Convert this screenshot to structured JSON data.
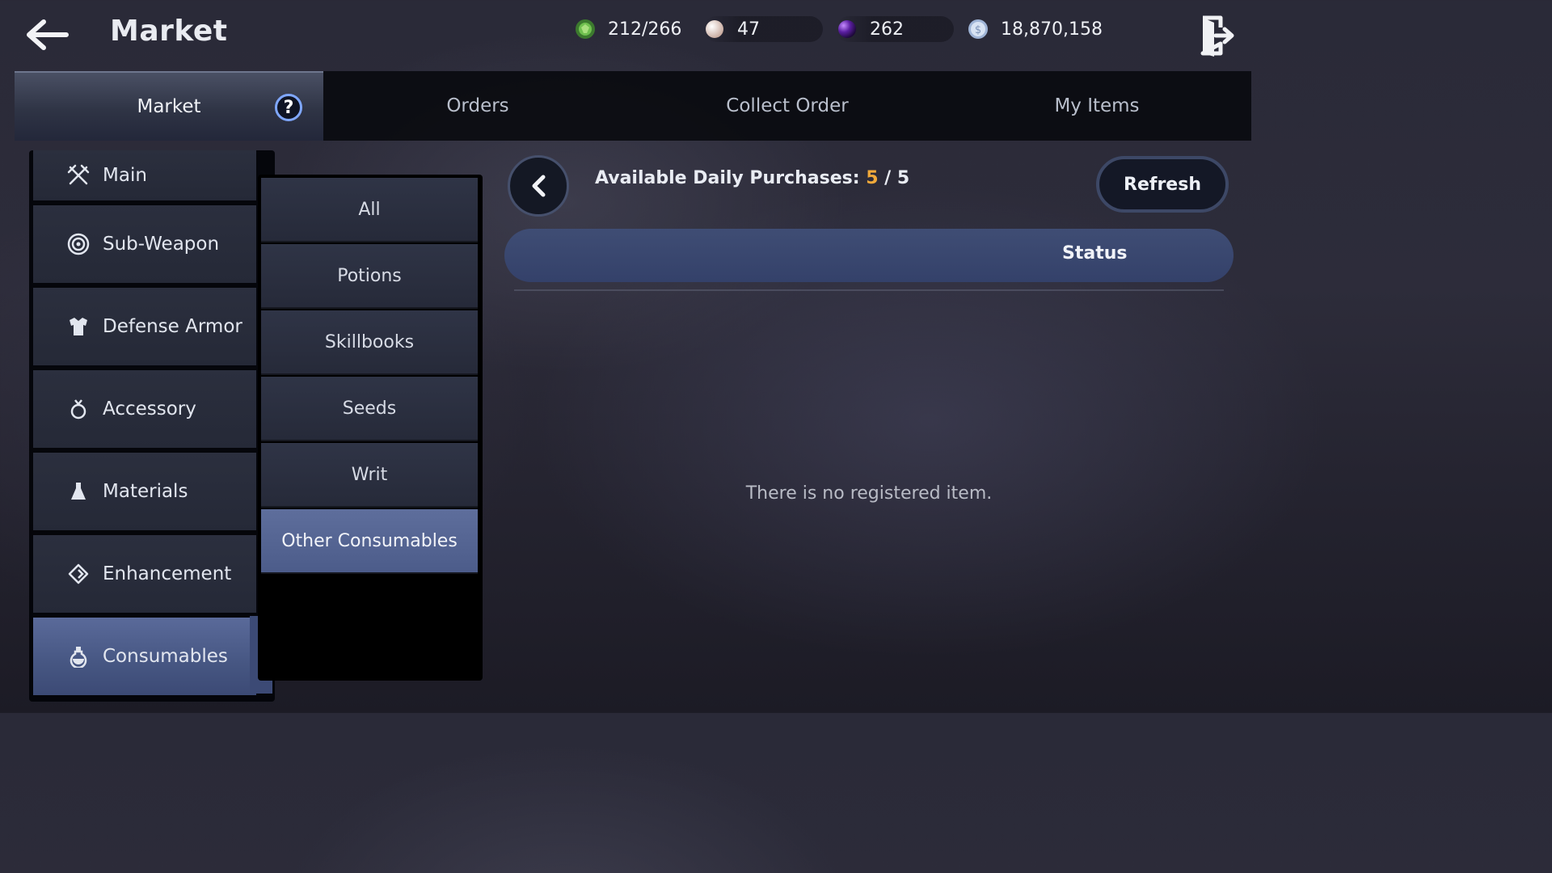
{
  "header": {
    "title": "Market",
    "back_icon": "arrow-left-icon",
    "exit_icon": "exit-door-icon"
  },
  "resources": [
    {
      "name": "weight",
      "icon": "green-gem-icon",
      "value": "212/266",
      "color": "#5db04a"
    },
    {
      "name": "pearl",
      "icon": "pearl-icon",
      "value": "47",
      "color": "#e8d6cf"
    },
    {
      "name": "black-pearl",
      "icon": "purple-orb-icon",
      "value": "262",
      "color": "#6b2fb3"
    },
    {
      "name": "silver",
      "icon": "silver-coin-icon",
      "value": "18,870,158",
      "color": "#b8c8e0"
    }
  ],
  "tabs": [
    {
      "label": "Market",
      "active": true
    },
    {
      "label": "Orders",
      "active": false
    },
    {
      "label": "Collect Order",
      "active": false
    },
    {
      "label": "My Items",
      "active": false
    }
  ],
  "help_label": "?",
  "categories": [
    {
      "label": "Main",
      "icon": "crossed-swords-icon",
      "active": false
    },
    {
      "label": "Sub-Weapon",
      "icon": "target-icon",
      "active": false
    },
    {
      "label": "Defense Armor",
      "icon": "armor-icon",
      "active": false
    },
    {
      "label": "Accessory",
      "icon": "ring-icon",
      "active": false
    },
    {
      "label": "Materials",
      "icon": "flask-icon",
      "active": false
    },
    {
      "label": "Enhancement",
      "icon": "diamond-icon",
      "active": false
    },
    {
      "label": "Consumables",
      "icon": "potion-icon",
      "active": true
    }
  ],
  "subcategories": [
    {
      "label": "All",
      "active": false
    },
    {
      "label": "Potions",
      "active": false
    },
    {
      "label": "Skillbooks",
      "active": false
    },
    {
      "label": "Seeds",
      "active": false
    },
    {
      "label": "Writ",
      "active": false
    },
    {
      "label": "Other Consumables",
      "active": true
    }
  ],
  "purchases": {
    "label": "Available Daily Purchases:",
    "current": "5",
    "separator": "/",
    "max": "5"
  },
  "refresh_label": "Refresh",
  "status_label": "Status",
  "empty_message": "There is no registered item.",
  "colors": {
    "accent_orange": "#f0a93a",
    "active_blue": "#4c5c8a",
    "help_blue": "#7fa7ff"
  }
}
